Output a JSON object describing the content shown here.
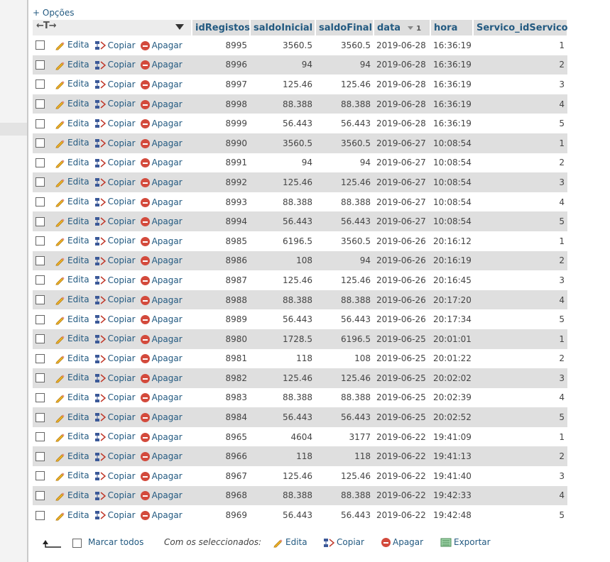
{
  "options_label": "+ Opções",
  "columns": [
    "idRegistos",
    "saldoInicial",
    "saldoFinal",
    "data",
    "hora",
    "Servico_idServico"
  ],
  "sort_indicator": "1",
  "actions": {
    "edit": "Edita",
    "copy": "Copiar",
    "delete": "Apagar"
  },
  "rows": [
    [
      "8995",
      "3560.5",
      "3560.5",
      "2019-06-28",
      "16:36:19",
      "1"
    ],
    [
      "8996",
      "94",
      "94",
      "2019-06-28",
      "16:36:19",
      "2"
    ],
    [
      "8997",
      "125.46",
      "125.46",
      "2019-06-28",
      "16:36:19",
      "3"
    ],
    [
      "8998",
      "88.388",
      "88.388",
      "2019-06-28",
      "16:36:19",
      "4"
    ],
    [
      "8999",
      "56.443",
      "56.443",
      "2019-06-28",
      "16:36:19",
      "5"
    ],
    [
      "8990",
      "3560.5",
      "3560.5",
      "2019-06-27",
      "10:08:54",
      "1"
    ],
    [
      "8991",
      "94",
      "94",
      "2019-06-27",
      "10:08:54",
      "2"
    ],
    [
      "8992",
      "125.46",
      "125.46",
      "2019-06-27",
      "10:08:54",
      "3"
    ],
    [
      "8993",
      "88.388",
      "88.388",
      "2019-06-27",
      "10:08:54",
      "4"
    ],
    [
      "8994",
      "56.443",
      "56.443",
      "2019-06-27",
      "10:08:54",
      "5"
    ],
    [
      "8985",
      "6196.5",
      "3560.5",
      "2019-06-26",
      "20:16:12",
      "1"
    ],
    [
      "8986",
      "108",
      "94",
      "2019-06-26",
      "20:16:19",
      "2"
    ],
    [
      "8987",
      "125.46",
      "125.46",
      "2019-06-26",
      "20:16:45",
      "3"
    ],
    [
      "8988",
      "88.388",
      "88.388",
      "2019-06-26",
      "20:17:20",
      "4"
    ],
    [
      "8989",
      "56.443",
      "56.443",
      "2019-06-26",
      "20:17:34",
      "5"
    ],
    [
      "8980",
      "1728.5",
      "6196.5",
      "2019-06-25",
      "20:01:01",
      "1"
    ],
    [
      "8981",
      "118",
      "108",
      "2019-06-25",
      "20:01:22",
      "2"
    ],
    [
      "8982",
      "125.46",
      "125.46",
      "2019-06-25",
      "20:02:02",
      "3"
    ],
    [
      "8983",
      "88.388",
      "88.388",
      "2019-06-25",
      "20:02:39",
      "4"
    ],
    [
      "8984",
      "56.443",
      "56.443",
      "2019-06-25",
      "20:02:52",
      "5"
    ],
    [
      "8965",
      "4604",
      "3177",
      "2019-06-22",
      "19:41:09",
      "1"
    ],
    [
      "8966",
      "118",
      "118",
      "2019-06-22",
      "19:41:13",
      "2"
    ],
    [
      "8967",
      "125.46",
      "125.46",
      "2019-06-22",
      "19:41:40",
      "3"
    ],
    [
      "8968",
      "88.388",
      "88.388",
      "2019-06-22",
      "19:42:33",
      "4"
    ],
    [
      "8969",
      "56.443",
      "56.443",
      "2019-06-22",
      "19:42:48",
      "5"
    ]
  ],
  "footer": {
    "check_all": "Marcar todos",
    "with_selected": "Com os seleccionados:",
    "edit": "Edita",
    "copy": "Copiar",
    "delete": "Apagar",
    "export": "Exportar"
  },
  "colors": {
    "link": "#235a81",
    "row_alt": "#dfdfdf",
    "header_bg": "#dedede",
    "delete": "#d34a3c"
  }
}
